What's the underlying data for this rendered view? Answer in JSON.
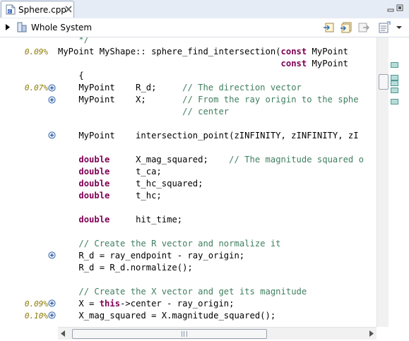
{
  "tab": {
    "title": "Sphere.cpp"
  },
  "toolbar": {
    "scope_label": "Whole System"
  },
  "ruler": {
    "percentages": [
      "0.09%",
      "0.07%",
      "0.09%",
      "0.10%"
    ]
  },
  "code": {
    "l0": "    */",
    "l1a": "MyPoint MyShape:: sphere_find_intersection(",
    "l1b": "const",
    "l1c": " MyPoint",
    "l2a": "                                           ",
    "l2b": "const",
    "l2c": " MyPoint",
    "l3": "    {",
    "l4a": "    MyPoint    R_d;     ",
    "l4b": "// The direction vector",
    "l5a": "    MyPoint    X;       ",
    "l5b": "// From the ray origin to the sphe",
    "l6a": "                        ",
    "l6b": "// center",
    "l8": "    MyPoint    intersection_point(zINFINITY, zINFINITY, zI",
    "l10a": "double",
    "l10b": "     X_mag_squared;    ",
    "l10c": "// The magnitude squared o",
    "l11a": "double",
    "l11b": "     t_ca;",
    "l12a": "double",
    "l12b": "     t_hc_squared;",
    "l13a": "double",
    "l13b": "     t_hc;",
    "l15a": "double",
    "l15b": "     hit_time;",
    "l17": "// Create the R vector and normalize it",
    "l18": "    R_d = ray_endpoint - ray_origin;",
    "l19": "    R_d = R_d.normalize();",
    "l21": "// Create the X vector and get its magnitude",
    "l22a": "    X = ",
    "l22b": "this",
    "l22c": "->center - ray_origin;",
    "l23": "    X_mag_squared = X.magnitude_squared();"
  },
  "colors": {
    "keyword": "#7f0055",
    "comment": "#3f7f5f",
    "coverage": "#8a7a00"
  }
}
